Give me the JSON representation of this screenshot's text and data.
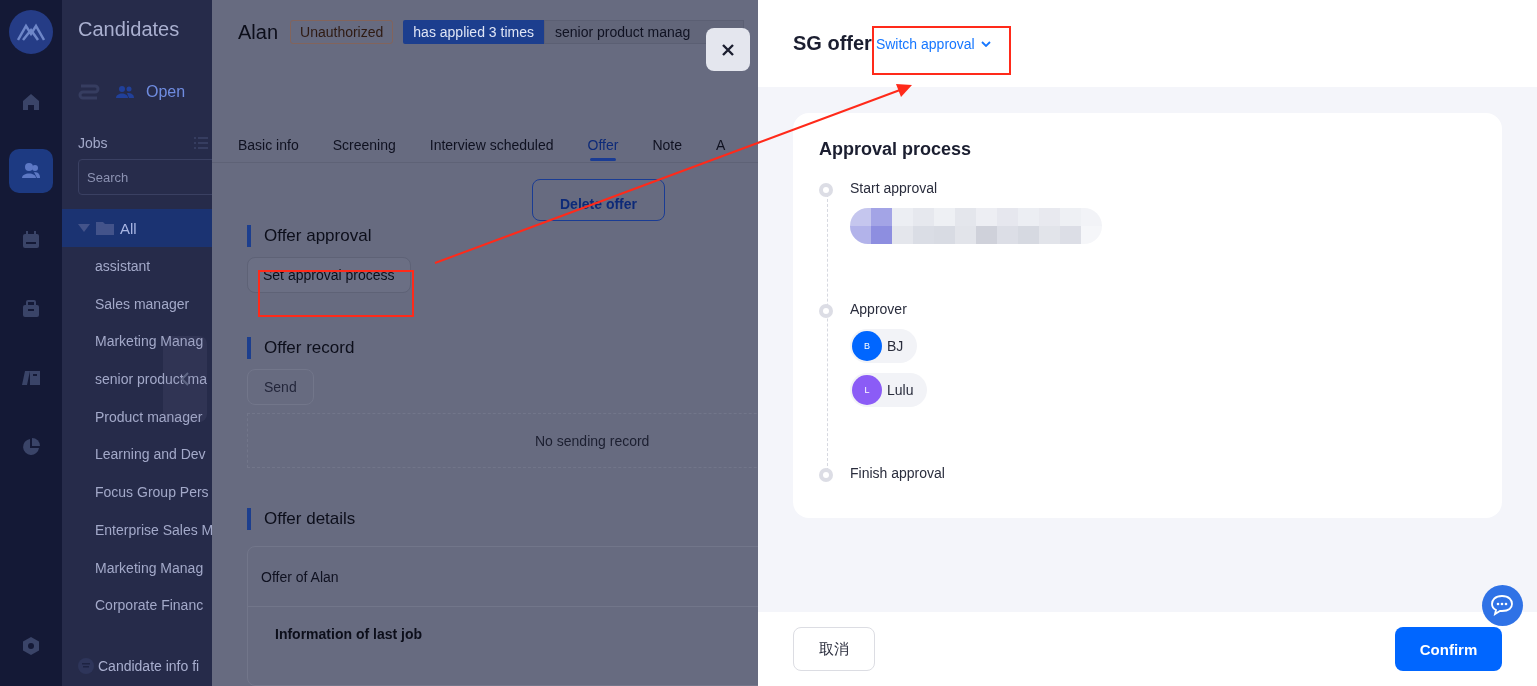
{
  "nav_rail": {
    "items": [
      {
        "selected": false
      },
      {
        "selected": true
      },
      {
        "selected": false
      },
      {
        "selected": false
      },
      {
        "selected": false
      },
      {
        "selected": false
      }
    ]
  },
  "jobs_panel": {
    "title": "Candidates",
    "view_tab": "Open",
    "jobs_label": "Jobs",
    "search": {
      "placeholder": "Search"
    },
    "folder": {
      "label": "All",
      "expanded": true,
      "selected": true
    },
    "items": [
      "assistant",
      "Sales manager",
      "Marketing Manag",
      "senior product ma",
      "Product manager",
      "Learning and Dev",
      "Focus Group Pers",
      "Enterprise Sales M",
      "Marketing Manag",
      "Corporate Financ"
    ],
    "footer_link": "Candidate info fi"
  },
  "candidate": {
    "name": "Alan",
    "status_badge": "Unauthorized",
    "applied_tag": "has applied 3 times",
    "position_tag": "senior product manag",
    "tabs": [
      {
        "label": "Basic info",
        "selected": false
      },
      {
        "label": "Screening",
        "selected": false
      },
      {
        "label": "Interview scheduled",
        "selected": false
      },
      {
        "label": "Offer",
        "selected": true
      },
      {
        "label": "Note",
        "selected": false
      },
      {
        "label": "A",
        "selected": false
      }
    ],
    "delete_button": "Delete offer",
    "sections": [
      {
        "kind": "approval",
        "title": "Offer approval",
        "button": "Set approval process"
      },
      {
        "kind": "record",
        "title": "Offer record",
        "button": "Send",
        "button_disabled": true,
        "empty_text": "No sending record"
      },
      {
        "kind": "details",
        "title": "Offer details",
        "card_title": "Offer of Alan",
        "subheading": "Information of last job"
      }
    ]
  },
  "modal": {
    "title": "SG offer",
    "switch_link": "Switch approval",
    "card_title": "Approval process",
    "steps": [
      {
        "kind": "start",
        "label": "Start approval"
      },
      {
        "kind": "approvers",
        "label": "Approver",
        "approvers": [
          {
            "initial": "B",
            "name": "BJ",
            "color": "#0066ff"
          },
          {
            "initial": "L",
            "name": "Lulu",
            "color": "#8b5cf6"
          }
        ]
      },
      {
        "kind": "finish",
        "label": "Finish approval"
      }
    ],
    "cancel_button": "取消",
    "confirm_button": "Confirm"
  }
}
